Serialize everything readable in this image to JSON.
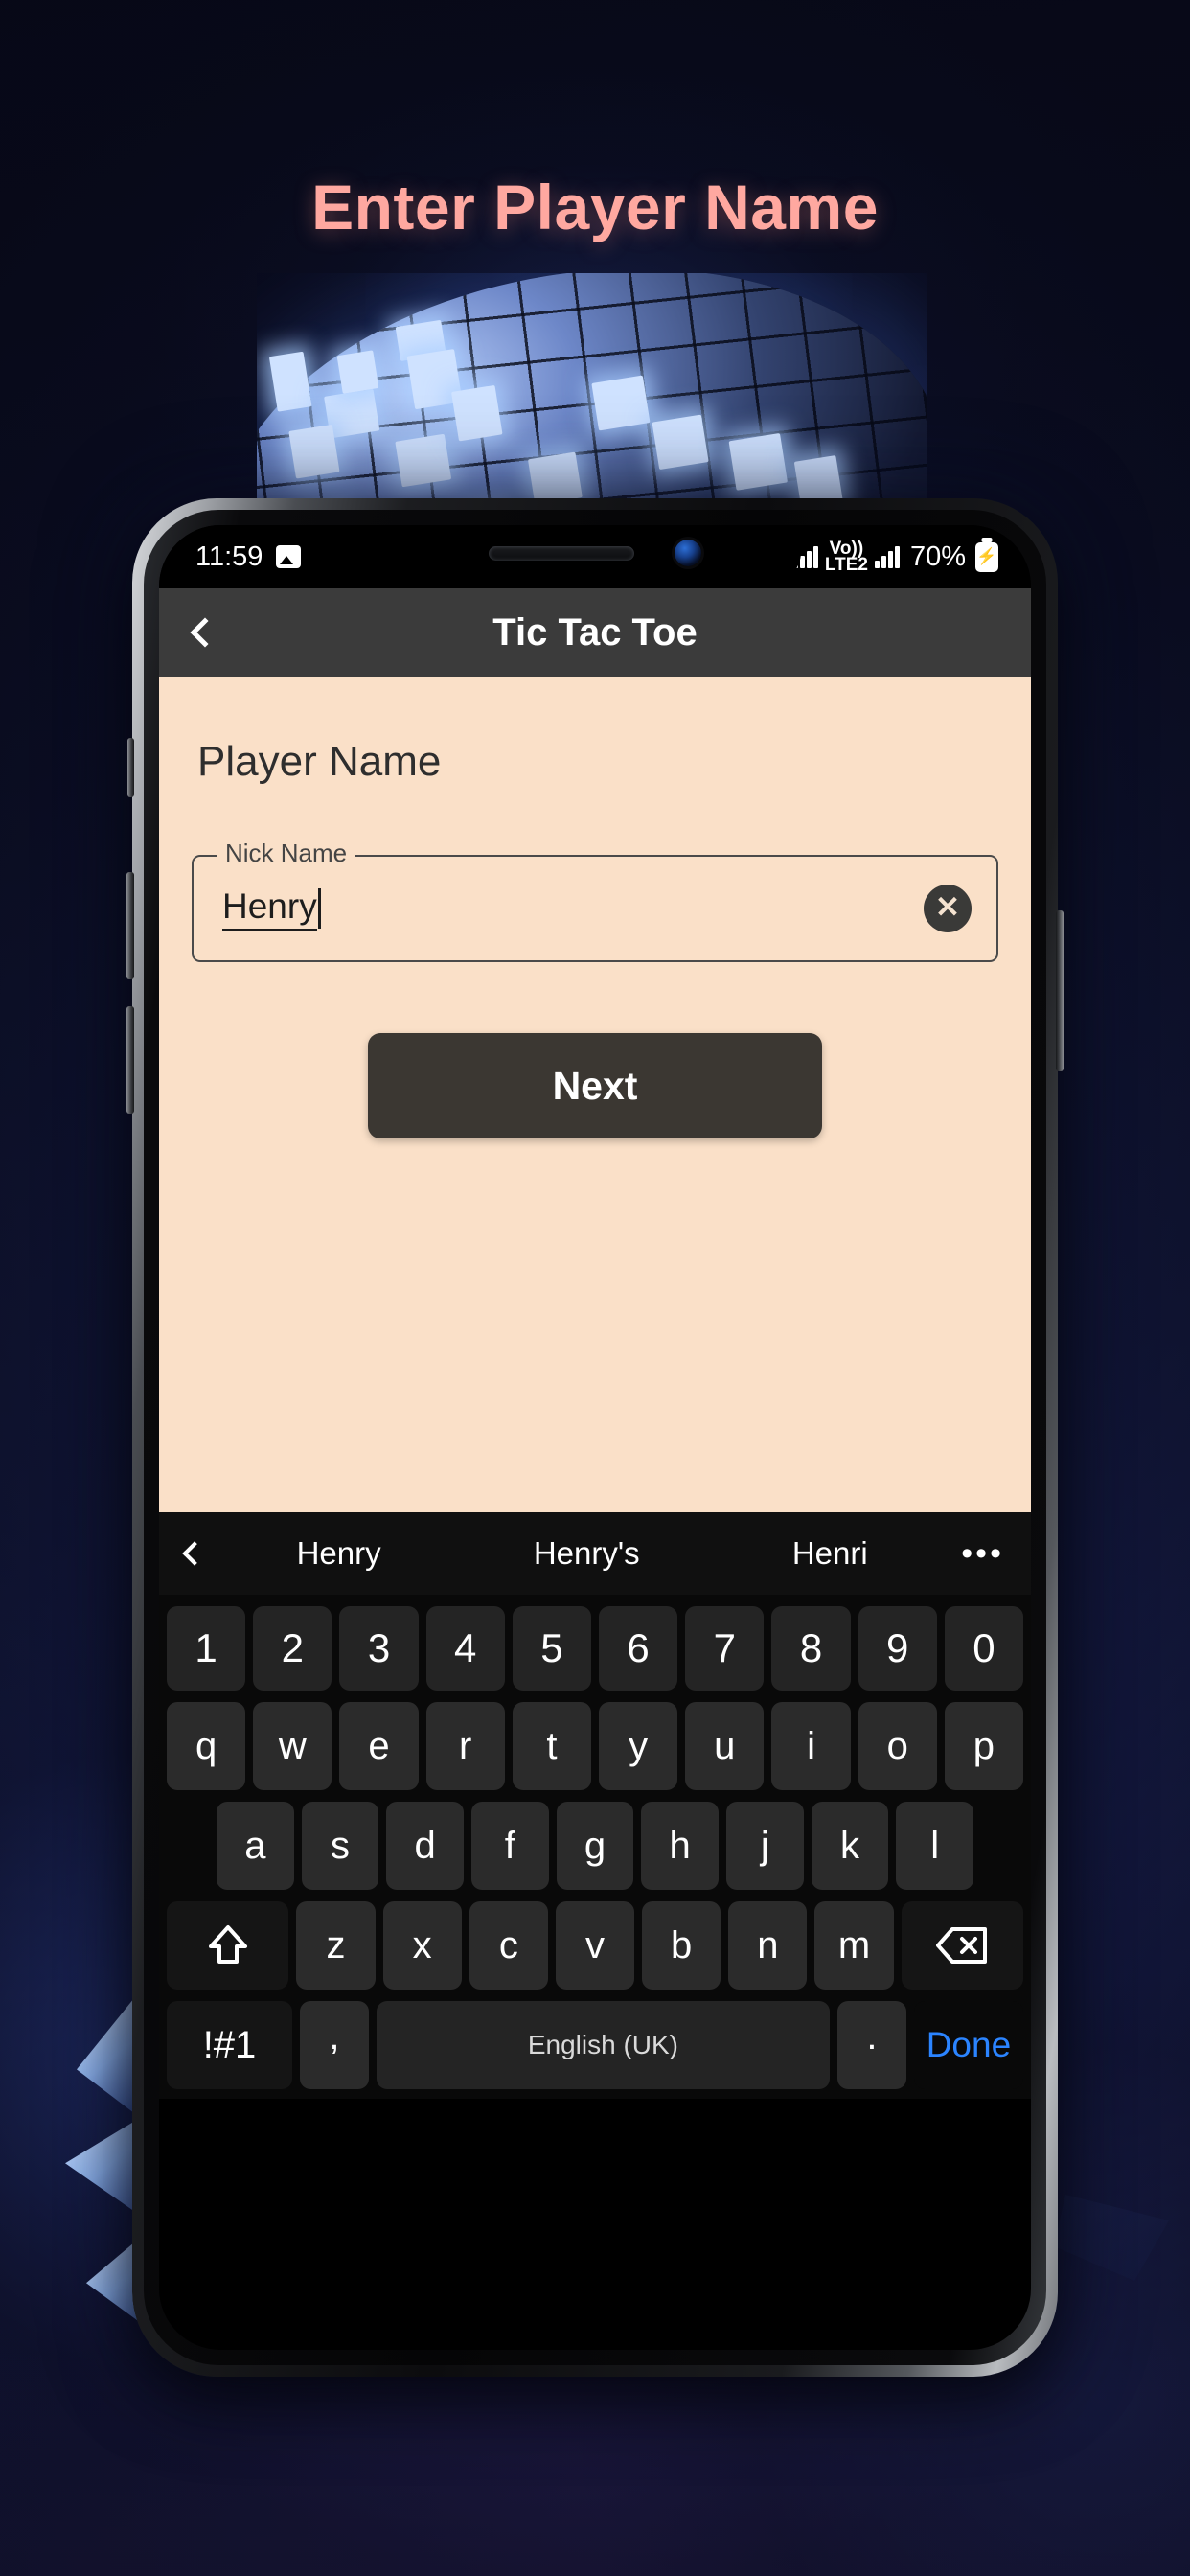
{
  "headline": "Enter Player Name",
  "statusbar": {
    "time": "11:59",
    "image_icon": "image-icon",
    "network_label": "Vo))",
    "network_sub": "LTE2",
    "battery_percent": "70%",
    "battery_icon": "charging-battery-icon"
  },
  "appbar": {
    "back_icon": "chevron-left-icon",
    "title": "Tic Tac Toe"
  },
  "content": {
    "page_title": "Player Name",
    "field": {
      "legend": "Nick Name",
      "value": "Henry",
      "placeholder": "Nick Name",
      "clear_icon": "clear-circle-icon"
    },
    "next_label": "Next"
  },
  "keyboard": {
    "suggestions": [
      "Henry",
      "Henry's",
      "Henri"
    ],
    "suggestion_back_icon": "chevron-left-icon",
    "suggestion_more": "•••",
    "row_numbers": [
      "1",
      "2",
      "3",
      "4",
      "5",
      "6",
      "7",
      "8",
      "9",
      "0"
    ],
    "row_top": [
      "q",
      "w",
      "e",
      "r",
      "t",
      "y",
      "u",
      "i",
      "o",
      "p"
    ],
    "row_home": [
      "a",
      "s",
      "d",
      "f",
      "g",
      "h",
      "j",
      "k",
      "l"
    ],
    "row_bottom": [
      "z",
      "x",
      "c",
      "v",
      "b",
      "n",
      "m"
    ],
    "shift_label": "shift-icon",
    "backspace_label": "backspace-icon",
    "symbols_label": "!#1",
    "comma_label": ",",
    "space_label": "English (UK)",
    "period_label": ".",
    "done_label": "Done"
  },
  "colors": {
    "accent_pink": "#ffa8a0",
    "content_bg": "#fae0c8",
    "appbar_bg": "#3b3b3b",
    "button_bg": "#3b3732",
    "done_blue": "#2b84ff"
  }
}
